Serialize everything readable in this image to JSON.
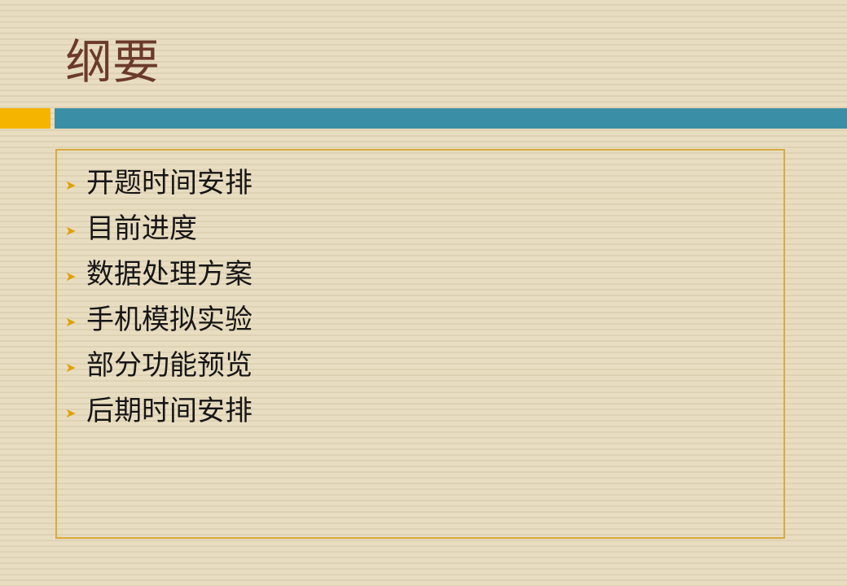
{
  "slide": {
    "title": "纲要",
    "accent_colors": {
      "yellow": "#f4b400",
      "blue": "#3a8fa6",
      "border": "#d8aa3e",
      "title": "#6b3a2a"
    },
    "bullet_icon": "arrow-right-icon",
    "items": [
      "开题时间安排",
      "目前进度",
      "数据处理方案",
      "手机模拟实验",
      "部分功能预览",
      "后期时间安排"
    ]
  }
}
